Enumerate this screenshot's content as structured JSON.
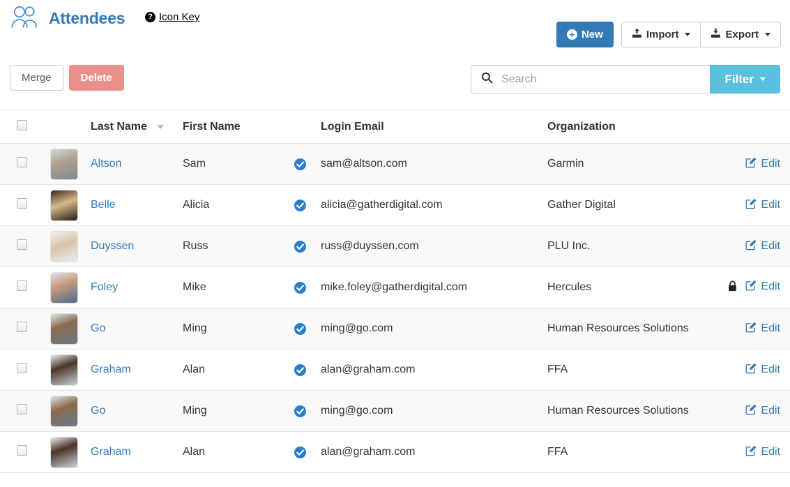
{
  "header": {
    "title": "Attendees",
    "people_icon": "people-icon",
    "icon_key": {
      "label": "Icon Key",
      "icon": "question-circle-icon"
    },
    "buttons": {
      "new": {
        "label": "New",
        "icon": "plus-circle-icon",
        "color": "#337ab7"
      },
      "import": {
        "label": "Import",
        "icon": "upload-icon",
        "caret": true
      },
      "export": {
        "label": "Export",
        "icon": "download-icon",
        "caret": true
      }
    }
  },
  "action_bar": {
    "merge": {
      "label": "Merge"
    },
    "delete": {
      "label": "Delete",
      "color": "#e9908c"
    },
    "search": {
      "placeholder": "Search",
      "value": "",
      "icon": "search-icon"
    },
    "filter": {
      "label": "Filter",
      "caret": true,
      "color": "#5bc0de"
    }
  },
  "table": {
    "columns": [
      {
        "key": "select",
        "label": ""
      },
      {
        "key": "avatar",
        "label": ""
      },
      {
        "key": "last_name",
        "label": "Last Name",
        "sorted": true,
        "sort_dir": "desc"
      },
      {
        "key": "first_name",
        "label": "First Name"
      },
      {
        "key": "verified",
        "label": ""
      },
      {
        "key": "login_email",
        "label": "Login Email"
      },
      {
        "key": "organization",
        "label": "Organization"
      },
      {
        "key": "edit",
        "label": ""
      }
    ],
    "edit_label": "Edit",
    "rows": [
      {
        "last_name": "Altson",
        "first_name": "Sam",
        "login_email": "sam@altson.com",
        "organization": "Garmin",
        "verified": true,
        "locked": false
      },
      {
        "last_name": "Belle",
        "first_name": "Alicia",
        "login_email": "alicia@gatherdigital.com",
        "organization": "Gather Digital",
        "verified": true,
        "locked": false
      },
      {
        "last_name": "Duyssen",
        "first_name": "Russ",
        "login_email": "russ@duyssen.com",
        "organization": "PLU Inc.",
        "verified": true,
        "locked": false
      },
      {
        "last_name": "Foley",
        "first_name": "Mike",
        "login_email": "mike.foley@gatherdigital.com",
        "organization": "Hercules",
        "verified": true,
        "locked": true
      },
      {
        "last_name": "Go",
        "first_name": "Ming",
        "login_email": "ming@go.com",
        "organization": "Human Resources Solutions",
        "verified": true,
        "locked": false
      },
      {
        "last_name": "Graham",
        "first_name": "Alan",
        "login_email": "alan@graham.com",
        "organization": "FFA",
        "verified": true,
        "locked": false
      },
      {
        "last_name": "Go",
        "first_name": "Ming",
        "login_email": "ming@go.com",
        "organization": "Human Resources Solutions",
        "verified": true,
        "locked": false
      },
      {
        "last_name": "Graham",
        "first_name": "Alan",
        "login_email": "alan@graham.com",
        "organization": "FFA",
        "verified": true,
        "locked": false
      }
    ]
  },
  "colors": {
    "link": "#337ab7",
    "primary": "#337ab7",
    "info": "#5bc0de",
    "danger": "#e9908c",
    "verified": "#2a7fc9",
    "stripe": "#f9f9f9",
    "border": "#e5e5e5"
  }
}
